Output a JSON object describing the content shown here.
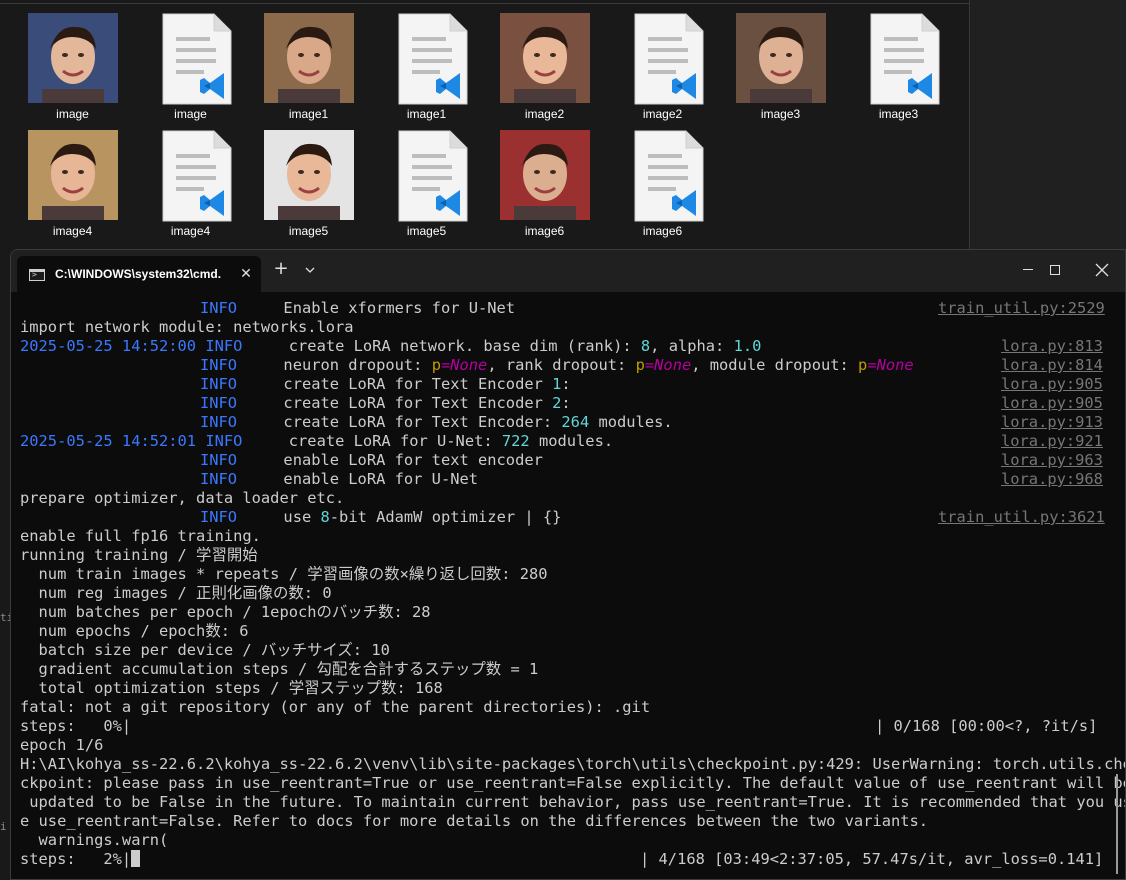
{
  "explorer": {
    "files": [
      {
        "label": "image",
        "type": "photo",
        "colors": [
          "#3a4d7a",
          "#e2b79a"
        ]
      },
      {
        "label": "image",
        "type": "vscode-doc"
      },
      {
        "label": "image1",
        "type": "photo",
        "colors": [
          "#8a6a4a",
          "#d8a888"
        ]
      },
      {
        "label": "image1",
        "type": "vscode-doc"
      },
      {
        "label": "image2",
        "type": "photo",
        "colors": [
          "#7a5040",
          "#e8b898"
        ]
      },
      {
        "label": "image2",
        "type": "vscode-doc"
      },
      {
        "label": "image3",
        "type": "photo",
        "colors": [
          "#6a5040",
          "#deb094"
        ]
      },
      {
        "label": "image3",
        "type": "vscode-doc"
      },
      {
        "label": "image4",
        "type": "photo",
        "colors": [
          "#b89460",
          "#e6b696"
        ]
      },
      {
        "label": "image4",
        "type": "vscode-doc"
      },
      {
        "label": "image5",
        "type": "photo",
        "colors": [
          "#e4e4e4",
          "#e8b898"
        ]
      },
      {
        "label": "image5",
        "type": "vscode-doc"
      },
      {
        "label": "image6",
        "type": "photo",
        "colors": [
          "#9a3030",
          "#dcae90"
        ]
      },
      {
        "label": "image6",
        "type": "vscode-doc"
      }
    ],
    "left_edge": {
      "a": "ti",
      "b": "i"
    }
  },
  "terminal": {
    "tab_title": "C:\\WINDOWS\\system32\\cmd.",
    "tab_close": "✕",
    "new_tab": "+",
    "lines": {
      "l0_info": "INFO",
      "l0_msg": "Enable xformers for U-Net",
      "l0_ref": "train_util.py:2529",
      "l1": "import network module: networks.lora",
      "l2_ts": "2025-05-25 14:52:00",
      "l2_info": "INFO",
      "l2_msg_a": "create LoRA network. base dim (rank): ",
      "l2_n1": "8",
      "l2_msg_b": ", alpha: ",
      "l2_n2": "1.0",
      "l2_ref": "lora.py:813",
      "l3_info": "INFO",
      "l3_a": "neuron dropout: ",
      "l3_k1": "p",
      "l3_eq1": "=",
      "l3_v1": "None",
      "l3_b": ", rank dropout: ",
      "l3_k2": "p",
      "l3_eq2": "=",
      "l3_v2": "None",
      "l3_c": ", module dropout: ",
      "l3_k3": "p",
      "l3_eq3": "=",
      "l3_v3": "None",
      "l3_ref": "lora.py:814",
      "l4_info": "INFO",
      "l4_a": "create LoRA for Text Encoder ",
      "l4_n": "1",
      "l4_b": ":",
      "l4_ref": "lora.py:905",
      "l5_info": "INFO",
      "l5_a": "create LoRA for Text Encoder ",
      "l5_n": "2",
      "l5_b": ":",
      "l5_ref": "lora.py:905",
      "l6_info": "INFO",
      "l6_a": "create LoRA for Text Encoder: ",
      "l6_n": "264",
      "l6_b": " modules.",
      "l6_ref": "lora.py:913",
      "l7_ts": "2025-05-25 14:52:01",
      "l7_info": "INFO",
      "l7_a": "create LoRA for U-Net: ",
      "l7_n": "722",
      "l7_b": " modules.",
      "l7_ref": "lora.py:921",
      "l8_info": "INFO",
      "l8_msg": "enable LoRA for text encoder",
      "l8_ref": "lora.py:963",
      "l9_info": "INFO",
      "l9_msg": "enable LoRA for U-Net",
      "l9_ref": "lora.py:968",
      "l10": "prepare optimizer, data loader etc.",
      "l11_info": "INFO",
      "l11_a": "use ",
      "l11_n": "8",
      "l11_b": "-bit AdamW optimizer | {}",
      "l11_ref": "train_util.py:3621",
      "l12": "enable full fp16 training.",
      "l13": "running training / 学習開始",
      "l14": "  num train images * repeats / 学習画像の数×繰り返し回数: 280",
      "l15": "  num reg images / 正則化画像の数: 0",
      "l16": "  num batches per epoch / 1epochのバッチ数: 28",
      "l17": "  num epochs / epoch数: 6",
      "l18": "  batch size per device / バッチサイズ: 10",
      "l19": "  gradient accumulation steps / 勾配を合計するステップ数 = 1",
      "l20": "  total optimization steps / 学習ステップ数: 168",
      "l21": "fatal: not a git repository (or any of the parent directories): .git",
      "l22_a": "steps:   0%|",
      "l22_b": "| 0/168 [00:00<?, ?it/s]",
      "l23": "epoch 1/6",
      "l24": "H:\\AI\\kohya_ss-22.6.2\\kohya_ss-22.6.2\\venv\\lib\\site-packages\\torch\\utils\\checkpoint.py:429: UserWarning: torch.utils.che",
      "l25": "ckpoint: please pass in use_reentrant=True or use_reentrant=False explicitly. The default value of use_reentrant will be",
      "l26": " updated to be False in the future. To maintain current behavior, pass use_reentrant=True. It is recommended that you us",
      "l27": "e use_reentrant=False. Refer to docs for more details on the differences between the two variants.",
      "l28": "  warnings.warn(",
      "l29_a": "steps:   2%|",
      "l29_b": "| 4/168 [03:49<2:37:05, 57.47s/it, avr_loss=0.141]"
    }
  },
  "colors": {
    "console_bg": "#0c0c0c",
    "text": "#cccccc",
    "info_blue": "#3b78ff",
    "cyan": "#61d6d6",
    "magenta": "#b4009e",
    "yellow": "#c19c00",
    "gray_ref": "#767676",
    "vscode_blue": "#1e88e5"
  }
}
